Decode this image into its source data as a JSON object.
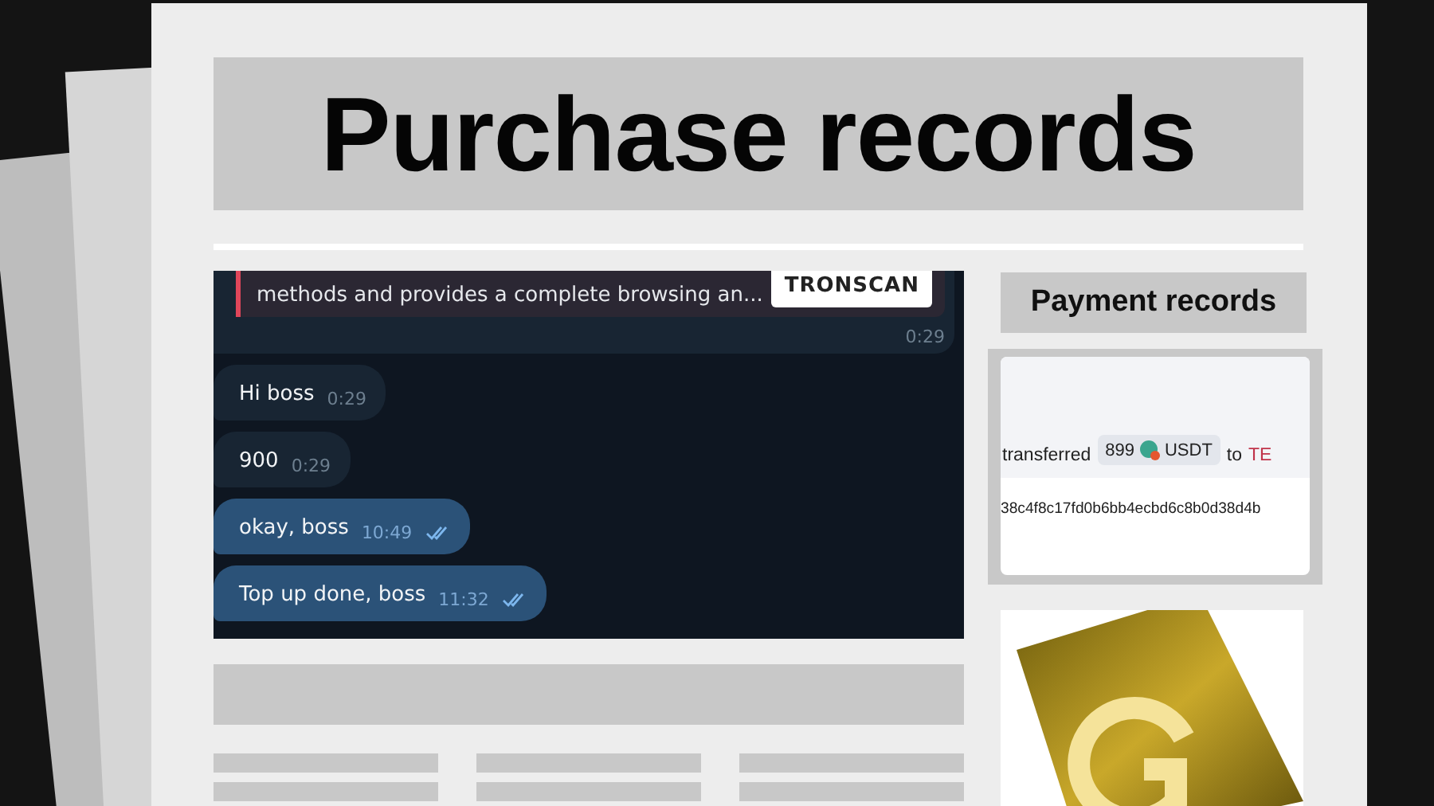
{
  "headline": "Purchase records",
  "chat": {
    "preview": {
      "text": "methods and provides a complete browsing an...",
      "logo": "TRONSCAN",
      "time": "0:29"
    },
    "messages": [
      {
        "kind": "incoming",
        "text": "Hi boss",
        "time": "0:29"
      },
      {
        "kind": "incoming",
        "text": "900",
        "time": "0:29"
      },
      {
        "kind": "outgoing",
        "text": "okay, boss",
        "time": "10:49",
        "read": true
      },
      {
        "kind": "outgoing",
        "text": "Top up done, boss",
        "time": "11:32",
        "read": true
      }
    ]
  },
  "payment": {
    "title": "Payment records",
    "verb": "transferred",
    "amount": "899",
    "token": "USDT",
    "to": "to",
    "recipient": "TE",
    "hash": "38c4f8c17fd0b6bb4ecbd6c8b0d38d4b"
  }
}
